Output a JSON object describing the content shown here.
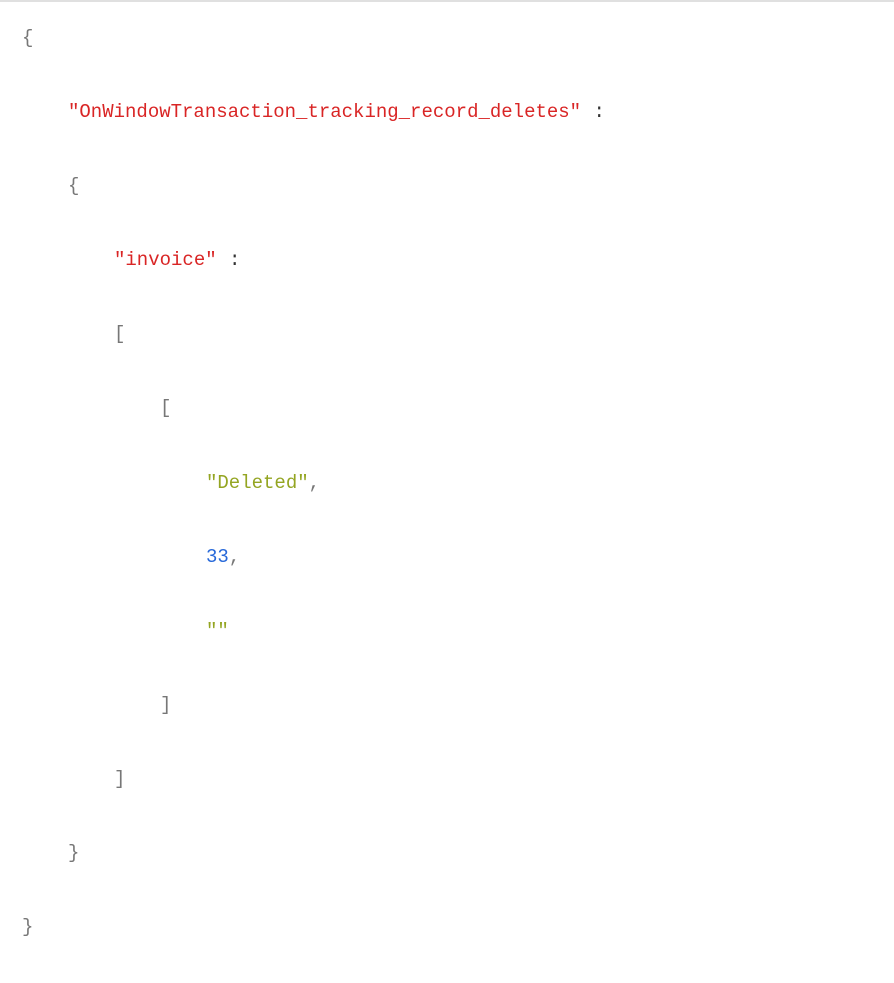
{
  "code": {
    "line1_brace_open": "{",
    "line2_key": "\"OnWindowTransaction_tracking_record_deletes\"",
    "line2_colon": " :",
    "line3_brace_open": "{",
    "line4_key": "\"invoice\"",
    "line4_colon": " :",
    "line5_bracket_open": "[",
    "line6_bracket_open": "[",
    "line7_str": "\"Deleted\"",
    "line7_comma": ",",
    "line8_num": "33",
    "line8_comma": ",",
    "line9_str": "\"\"",
    "line10_bracket_close": "]",
    "line11_bracket_close": "]",
    "line12_brace_close": "}",
    "line13_brace_close": "}"
  }
}
